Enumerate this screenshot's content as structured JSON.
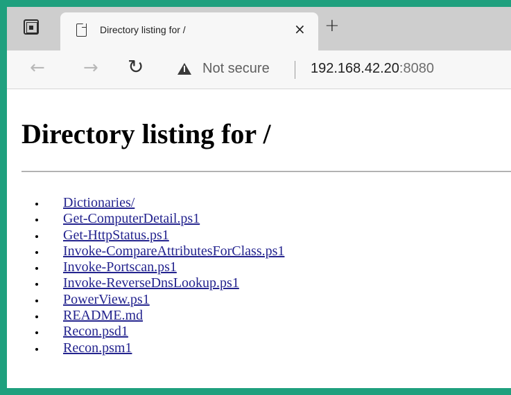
{
  "browser": {
    "tab": {
      "title": "Directory listing for /",
      "close_glyph": "×",
      "page_icon": "page-icon"
    },
    "new_tab_glyph": "+",
    "tab_actions_icon": "tab-actions-icon",
    "nav": {
      "back_glyph": "←",
      "forward_glyph": "→",
      "reload_glyph": "↻"
    },
    "address_bar": {
      "security_icon": "warning-triangle-icon",
      "security_text": "Not secure",
      "host": "192.168.42.20",
      "port": ":8080"
    }
  },
  "page": {
    "heading": "Directory listing for /",
    "files": [
      "Dictionaries/",
      "Get-ComputerDetail.ps1",
      "Get-HttpStatus.ps1",
      "Invoke-CompareAttributesForClass.ps1",
      "Invoke-Portscan.ps1",
      "Invoke-ReverseDnsLookup.ps1",
      "PowerView.ps1",
      "README.md",
      "Recon.psd1",
      "Recon.psm1"
    ]
  },
  "colors": {
    "frame_border": "#1fa07e",
    "tabstrip_bg": "#cecece",
    "toolbar_bg": "#f7f7f7",
    "link": "#23238e"
  }
}
